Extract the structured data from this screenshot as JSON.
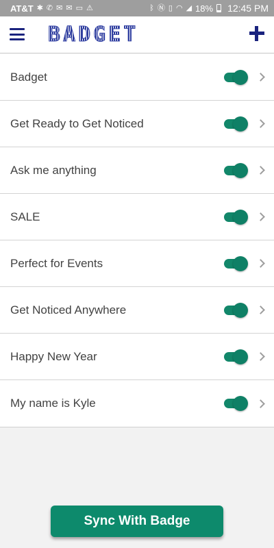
{
  "status_bar": {
    "carrier": "AT&T",
    "battery": "18%",
    "time": "12:45 PM",
    "left_icons": [
      "slack-icon",
      "call-icon",
      "gmail-icon",
      "gmail-icon",
      "message-icon",
      "warning-icon"
    ],
    "right_icons": [
      "bluetooth-icon",
      "nfc-icon",
      "vibrate-icon",
      "wifi-icon",
      "signal-icon"
    ]
  },
  "app_bar": {
    "logo_text": "BADGET",
    "menu_icon": "hamburger-menu-icon",
    "add_icon": "plus-icon"
  },
  "badges": [
    {
      "label": "Badget",
      "enabled": true
    },
    {
      "label": "Get Ready to Get Noticed",
      "enabled": true
    },
    {
      "label": "Ask me anything",
      "enabled": true
    },
    {
      "label": "SALE",
      "enabled": true
    },
    {
      "label": "Perfect for Events",
      "enabled": true
    },
    {
      "label": "Get Noticed Anywhere",
      "enabled": true
    },
    {
      "label": "Happy New Year",
      "enabled": true
    },
    {
      "label": "My name is Kyle",
      "enabled": true
    }
  ],
  "sync_button": {
    "label": "Sync With Badge"
  },
  "colors": {
    "accent": "#0d8a6c",
    "app_bar_icons": "#1a237e",
    "status_bar": "#9e9e9e",
    "background": "#f2f2f2"
  }
}
